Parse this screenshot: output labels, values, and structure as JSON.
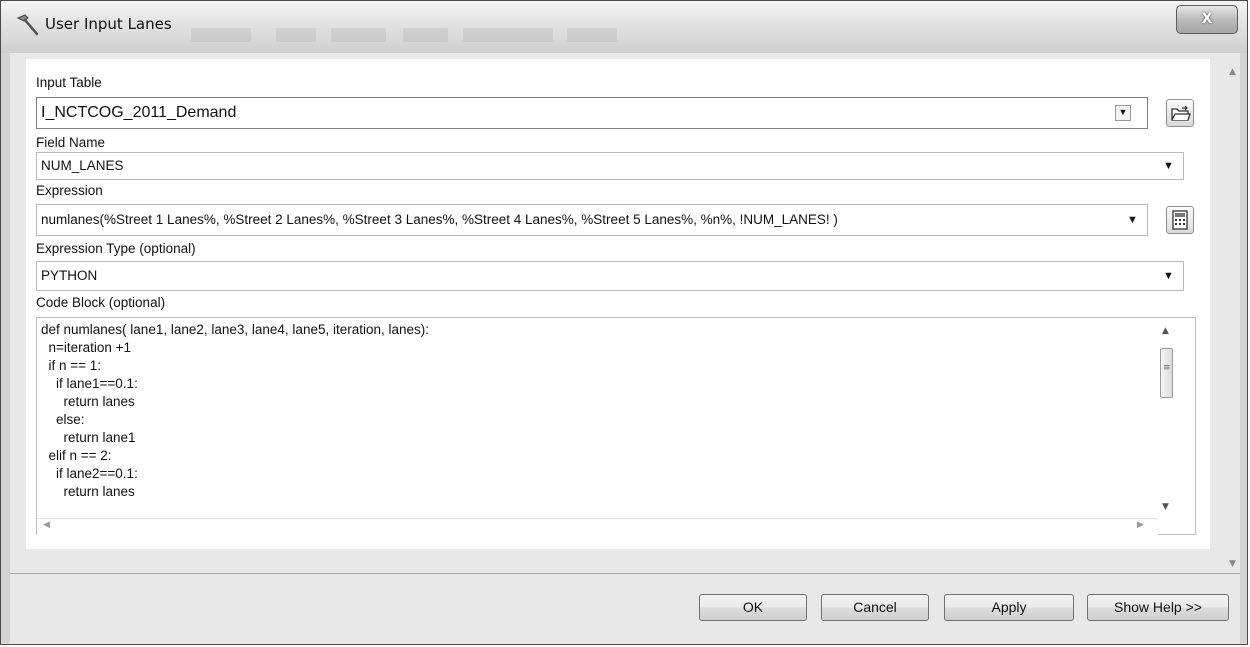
{
  "window": {
    "title": "User Input Lanes",
    "close_glyph": "X"
  },
  "form": {
    "input_table": {
      "label": "Input Table",
      "value": "I_NCTCOG_2011_Demand"
    },
    "field_name": {
      "label": "Field Name",
      "value": "NUM_LANES"
    },
    "expression": {
      "label": "Expression",
      "value": "numlanes(%Street 1 Lanes%, %Street 2 Lanes%, %Street 3 Lanes%, %Street 4 Lanes%, %Street 5 Lanes%, %n%, !NUM_LANES! )"
    },
    "expression_type": {
      "label": "Expression Type (optional)",
      "value": "PYTHON"
    },
    "code_block": {
      "label": "Code Block (optional)",
      "lines": [
        "def numlanes( lane1, lane2, lane3, lane4, lane5, iteration, lanes):",
        "  n=iteration +1",
        "  if n == 1:",
        "    if lane1==0.1:",
        "      return lanes",
        "    else:",
        "      return lane1",
        "  elif n == 2:",
        "    if lane2==0.1:",
        "      return lanes"
      ]
    }
  },
  "buttons": {
    "ok": "OK",
    "cancel": "Cancel",
    "apply": "Apply",
    "show_help": "Show Help >>"
  },
  "icons": {
    "title": "hammer-icon",
    "browse": "open-folder-icon",
    "calculator": "calculator-icon"
  }
}
